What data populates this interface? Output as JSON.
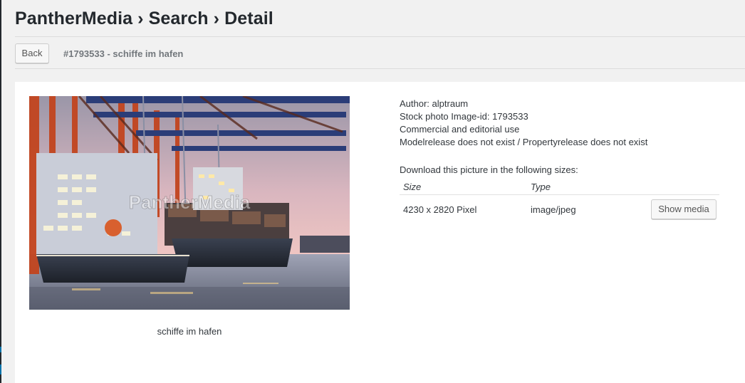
{
  "page": {
    "title": "PantherMedia › Search › Detail"
  },
  "toolbar": {
    "back_label": "Back",
    "subtitle": "#1793533 - schiffe im hafen"
  },
  "image": {
    "watermark": "PantherMedia",
    "caption": "schiffe im hafen"
  },
  "meta": {
    "author_label": "Author:",
    "author": "alptraum",
    "image_id_line": "Stock photo Image-id: 1793533",
    "usage": "Commercial and editorial use",
    "release": "Modelrelease does not exist / Propertyrelease does not exist"
  },
  "downloads": {
    "title": "Download this picture in the following sizes:",
    "headers": {
      "size": "Size",
      "type": "Type"
    },
    "rows": [
      {
        "size": "4230 x 2820 Pixel",
        "type": "image/jpeg",
        "action": "Show media"
      }
    ]
  }
}
